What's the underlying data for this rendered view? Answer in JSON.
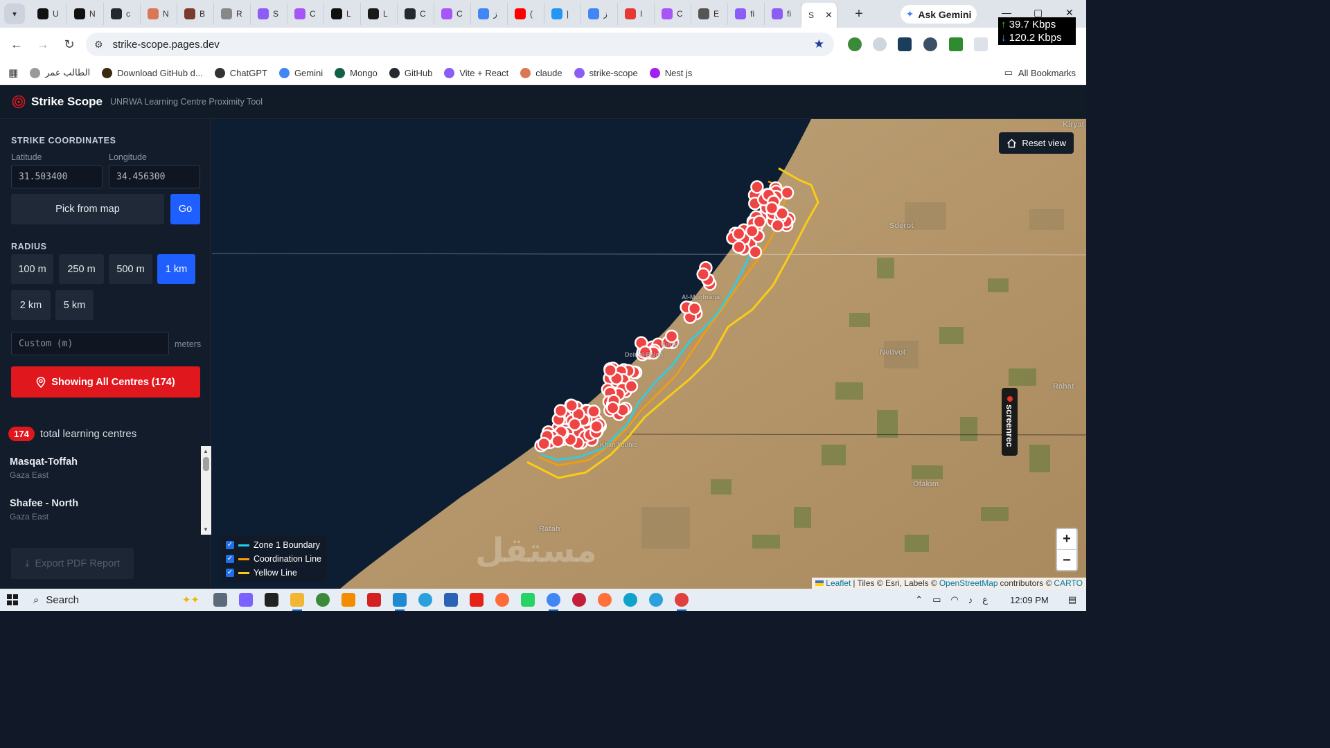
{
  "browser": {
    "tabs": [
      {
        "label": "U",
        "color": "#111111"
      },
      {
        "label": "N",
        "color": "#111111"
      },
      {
        "label": "c",
        "color": "#24292f"
      },
      {
        "label": "N",
        "color": "#d97757"
      },
      {
        "label": "B",
        "color": "#7b3b2a"
      },
      {
        "label": "R",
        "color": "#888888"
      },
      {
        "label": "S",
        "color": "#8b5cf6"
      },
      {
        "label": "C",
        "color": "#a855f7"
      },
      {
        "label": "L",
        "color": "#111111"
      },
      {
        "label": "L",
        "color": "#1a1a1a"
      },
      {
        "label": "C",
        "color": "#24292f"
      },
      {
        "label": "C",
        "color": "#a855f7"
      },
      {
        "label": "ز",
        "color": "#4285f4"
      },
      {
        "label": "(",
        "color": "#ff0000"
      },
      {
        "label": "|",
        "color": "#2196f3"
      },
      {
        "label": "ز",
        "color": "#4285f4"
      },
      {
        "label": "I",
        "color": "#e53935"
      },
      {
        "label": "C",
        "color": "#a855f7"
      },
      {
        "label": "E",
        "color": "#555555"
      },
      {
        "label": "fi",
        "color": "#8b5cf6"
      },
      {
        "label": "fi",
        "color": "#8b5cf6"
      }
    ],
    "active_tab": {
      "label": "S",
      "close": "✕"
    },
    "new_tab": "+",
    "ask_gemini": "Ask Gemini",
    "net_up": "39.7 Kbps",
    "net_down": "120.2 Kbps",
    "url": "strike-scope.pages.dev",
    "bookmarks": [
      {
        "label": "الطالب عمر",
        "color": "#999999"
      },
      {
        "label": "Download GitHub d...",
        "color": "#3a2a10"
      },
      {
        "label": "ChatGPT",
        "color": "#333333"
      },
      {
        "label": "Gemini",
        "color": "#4285f4"
      },
      {
        "label": "Mongo",
        "color": "#116149"
      },
      {
        "label": "GitHub",
        "color": "#24292f"
      },
      {
        "label": "Vite + React",
        "color": "#8b5cf6"
      },
      {
        "label": "claude",
        "color": "#d97757"
      },
      {
        "label": "strike-scope",
        "color": "#8b5cf6"
      },
      {
        "label": "Nest js",
        "color": "#a020f0"
      }
    ],
    "all_bookmarks": "All Bookmarks"
  },
  "app": {
    "title": "Strike Scope",
    "subtitle": "UNRWA Learning Centre Proximity Tool",
    "accent": "#e1171e",
    "primary": "#1f5eff"
  },
  "sidebar": {
    "coords_heading": "STRIKE COORDINATES",
    "latitude_label": "Latitude",
    "latitude_value": "31.503400",
    "longitude_label": "Longitude",
    "longitude_value": "34.456300",
    "pick_button": "Pick from map",
    "go_button": "Go",
    "radius_heading": "RADIUS",
    "radius_options": [
      "100 m",
      "250 m",
      "500 m",
      "1 km",
      "2 km",
      "5 km"
    ],
    "radius_selected": "1 km",
    "custom_placeholder": "Custom (m)",
    "custom_unit": "meters",
    "show_all_button": "Showing All Centres (174)",
    "count": "174",
    "count_label": "total learning centres",
    "centres": [
      {
        "name": "Masqat-Toffah",
        "region": "Gaza East"
      },
      {
        "name": "Shafee - North",
        "region": "Gaza East"
      }
    ],
    "export_button": "Export PDF Report"
  },
  "map": {
    "reset_view": "Reset view",
    "zoom_in": "+",
    "zoom_out": "−",
    "legend": [
      {
        "label": "Zone 1 Boundary",
        "color": "#22d3ee",
        "checked": true
      },
      {
        "label": "Coordination Line",
        "color": "#f59e0b",
        "checked": true
      },
      {
        "label": "Yellow Line",
        "color": "#facc15",
        "checked": true
      }
    ],
    "places": [
      "Kiryat",
      "Sderot",
      "Netivot",
      "Rahat",
      "Ofakim",
      "Rafah",
      "Al-Mughraqa",
      "Deir al-Balah",
      "Bureij",
      "Khan Younis"
    ],
    "screenrec": "screenrec",
    "watermark": "مستقل",
    "attribution": {
      "leaflet": "Leaflet",
      "tiles": "| Tiles © Esri, Labels ©",
      "osm": "OpenStreetMap",
      "contributors": "contributors ©",
      "carto": "CARTO"
    },
    "marker_color": "#ef4444"
  },
  "taskbar": {
    "search": "Search",
    "lang": "ع",
    "time": "12:09 PM"
  }
}
